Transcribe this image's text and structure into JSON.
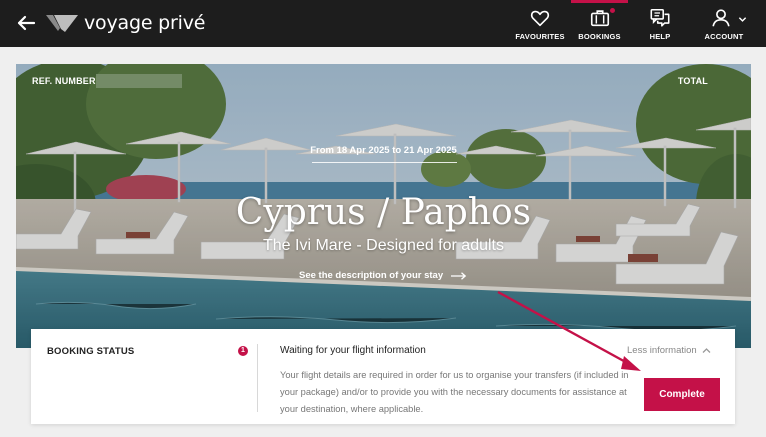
{
  "header": {
    "logo_text": "voyage privé",
    "nav": [
      {
        "label": "FAVOURITES",
        "icon": "heart-icon"
      },
      {
        "label": "BOOKINGS",
        "icon": "suitcase-icon",
        "active": true
      },
      {
        "label": "HELP",
        "icon": "chat-help-icon"
      },
      {
        "label": "ACCOUNT",
        "icon": "user-icon"
      }
    ]
  },
  "hero": {
    "ref_label": "REF. NUMBER",
    "total_label": "TOTAL",
    "dates": "From 18 Apr 2025 to 21 Apr 2025",
    "destination": "Cyprus / Paphos",
    "hotel": "The Ivi Mare - Designed for adults",
    "description_link": "See the description of your stay"
  },
  "booking_status": {
    "title": "BOOKING STATUS",
    "badge_count": "1",
    "status_text": "Waiting for your flight information",
    "toggle_label": "Less information",
    "details": "Your flight details are required in order for us to organise your transfers (if included in your package) and/or to provide you with the necessary documents for assistance at your destination, where applicable.",
    "action_label": "Complete"
  },
  "colors": {
    "accent": "#c41148",
    "topbar": "#1d1d1d",
    "annotation_arrow": "#c41148"
  }
}
